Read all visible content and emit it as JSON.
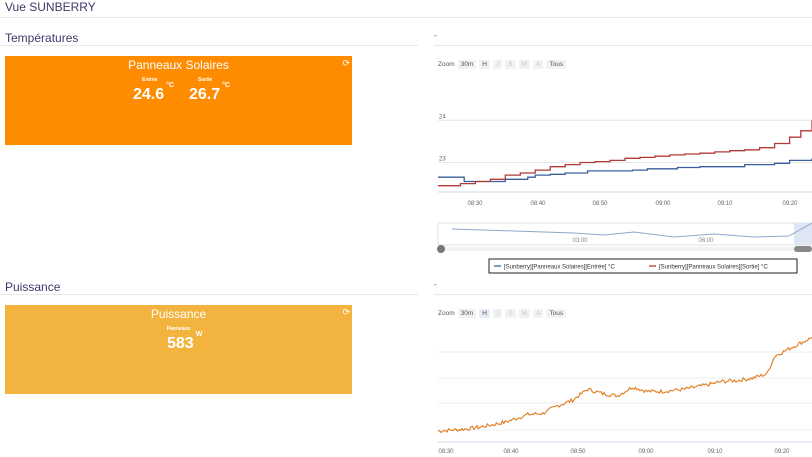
{
  "page": {
    "title": "Vue SUNBERRY"
  },
  "sections": {
    "temps": {
      "title": "Températures",
      "tile": {
        "title": "Panneaux Solaires",
        "labels": [
          "Entrée",
          "Sortie"
        ],
        "values": [
          "24.6",
          "26.7"
        ],
        "unit": "°C",
        "color": "#ff8c00"
      },
      "chart_dash": "-"
    },
    "power": {
      "title": "Puissance",
      "tile": {
        "title": "Puissance",
        "label": "Panneaux",
        "value": "583",
        "unit": "W",
        "color": "#f3b43f"
      },
      "chart_dash": "-"
    }
  },
  "zoom_buttons": {
    "label": "Zoom",
    "items": [
      "30m",
      "H",
      "J",
      "S",
      "M",
      "A",
      "Tous"
    ]
  },
  "icons": {
    "refresh": "refresh-icon"
  },
  "chart_data": [
    {
      "type": "line",
      "title": "",
      "x": [
        "08:30",
        "08:40",
        "08:50",
        "09:00",
        "09:10",
        "09:20"
      ],
      "yticks": [
        "24",
        "23"
      ],
      "ylim": [
        22.3,
        24.6
      ],
      "navigator_labels": [
        "03:00",
        "06:00"
      ],
      "series": [
        {
          "name": "[Sunberry][Panneaux Solaires][Entrée] °C",
          "color": "#3a5f9f",
          "points": [
            [
              0,
              22.65
            ],
            [
              5,
              22.65
            ],
            [
              7,
              22.55
            ],
            [
              15,
              22.55
            ],
            [
              18,
              22.6
            ],
            [
              22,
              22.6
            ],
            [
              24,
              22.65
            ],
            [
              26,
              22.7
            ],
            [
              30,
              22.72
            ],
            [
              34,
              22.75
            ],
            [
              38,
              22.75
            ],
            [
              40,
              22.8
            ],
            [
              48,
              22.8
            ],
            [
              52,
              22.82
            ],
            [
              56,
              22.85
            ],
            [
              60,
              22.85
            ],
            [
              64,
              22.88
            ],
            [
              70,
              22.9
            ],
            [
              78,
              22.9
            ],
            [
              82,
              22.95
            ],
            [
              86,
              22.95
            ],
            [
              90,
              22.98
            ],
            [
              94,
              23.05
            ],
            [
              100,
              23.1
            ]
          ]
        },
        {
          "name": "[Sunberry][Panneaux Solaires][Sortie] °C",
          "color": "#b03a3a",
          "points": [
            [
              0,
              22.45
            ],
            [
              3,
              22.45
            ],
            [
              6,
              22.5
            ],
            [
              10,
              22.55
            ],
            [
              14,
              22.6
            ],
            [
              18,
              22.7
            ],
            [
              22,
              22.75
            ],
            [
              26,
              22.82
            ],
            [
              30,
              22.9
            ],
            [
              34,
              22.95
            ],
            [
              38,
              23.0
            ],
            [
              42,
              23.02
            ],
            [
              46,
              23.05
            ],
            [
              50,
              23.1
            ],
            [
              54,
              23.12
            ],
            [
              58,
              23.15
            ],
            [
              62,
              23.18
            ],
            [
              66,
              23.2
            ],
            [
              70,
              23.22
            ],
            [
              74,
              23.25
            ],
            [
              78,
              23.28
            ],
            [
              82,
              23.3
            ],
            [
              86,
              23.35
            ],
            [
              90,
              23.45
            ],
            [
              94,
              23.6
            ],
            [
              97,
              23.75
            ],
            [
              100,
              24.0
            ]
          ]
        }
      ]
    },
    {
      "type": "line",
      "title": "",
      "x": [
        "08:30",
        "08:40",
        "08:50",
        "09:00",
        "09:10",
        "09:20"
      ],
      "series": [
        {
          "name": "Puissance",
          "color": "#e07b1f",
          "points": [
            [
              0,
              0.1
            ],
            [
              8,
              0.12
            ],
            [
              12,
              0.14
            ],
            [
              18,
              0.18
            ],
            [
              24,
              0.25
            ],
            [
              28,
              0.26
            ],
            [
              32,
              0.33
            ],
            [
              36,
              0.38
            ],
            [
              40,
              0.48
            ],
            [
              44,
              0.44
            ],
            [
              48,
              0.42
            ],
            [
              52,
              0.5
            ],
            [
              56,
              0.46
            ],
            [
              60,
              0.46
            ],
            [
              66,
              0.48
            ],
            [
              72,
              0.52
            ],
            [
              76,
              0.55
            ],
            [
              80,
              0.56
            ],
            [
              84,
              0.58
            ],
            [
              88,
              0.62
            ],
            [
              90,
              0.78
            ],
            [
              94,
              0.85
            ],
            [
              100,
              0.95
            ]
          ]
        }
      ]
    }
  ]
}
